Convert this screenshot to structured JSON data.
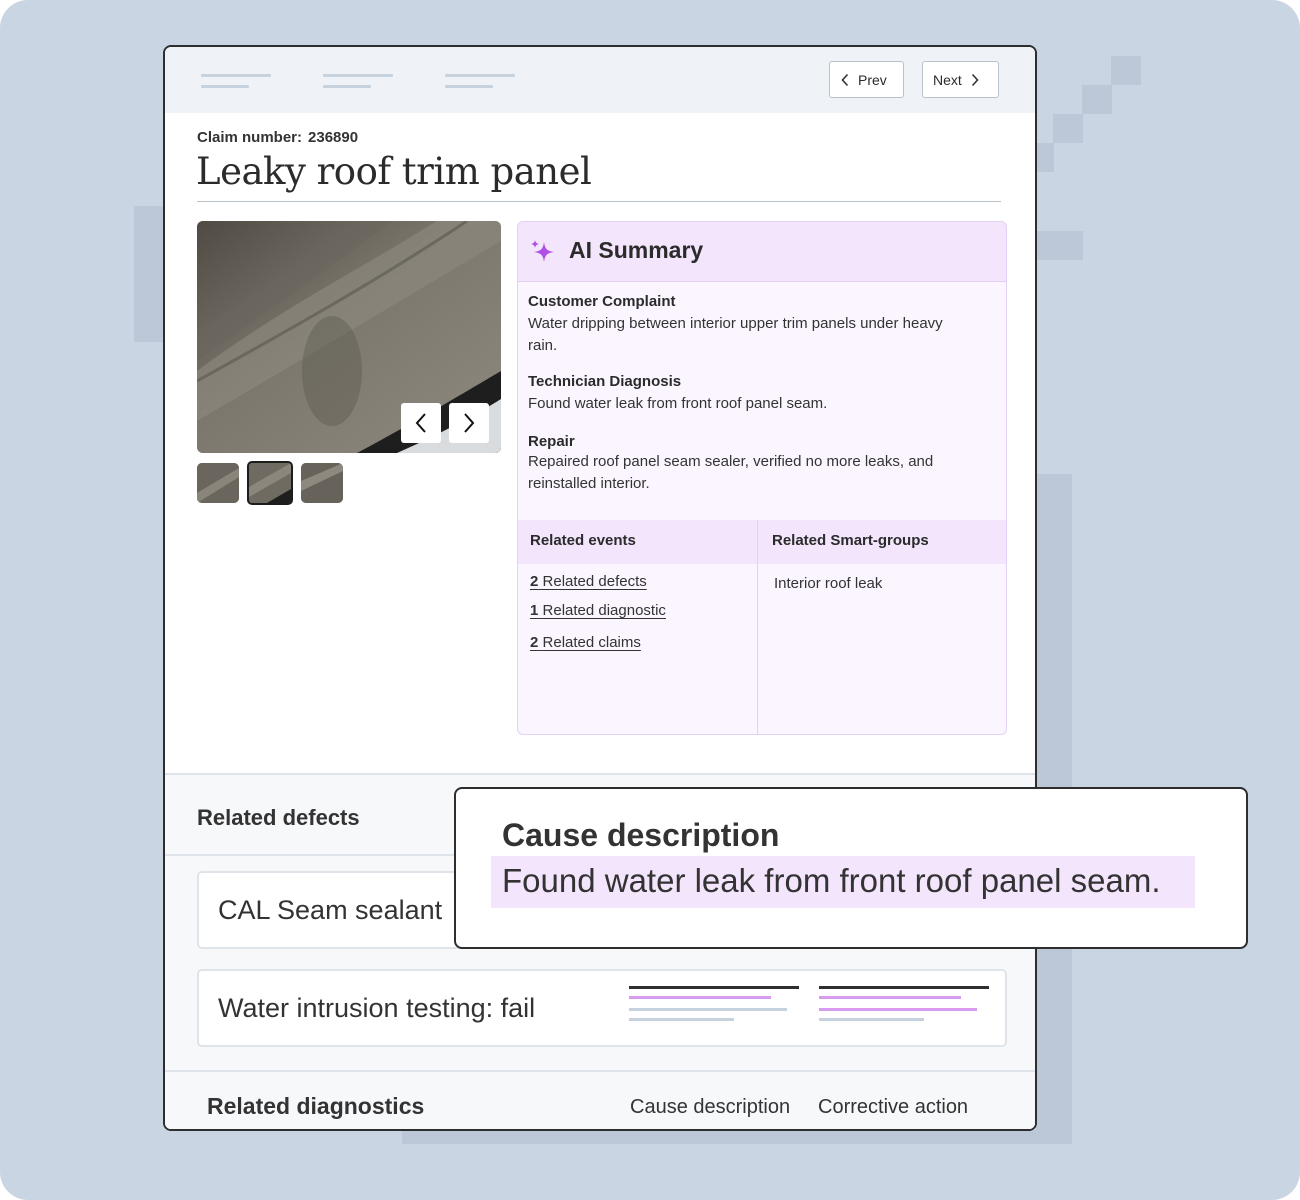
{
  "nav": {
    "prev_label": "Prev",
    "next_label": "Next"
  },
  "claim": {
    "number_label": "Claim number:",
    "number": "236890",
    "title": "Leaky roof trim panel"
  },
  "ai_summary": {
    "title": "AI Summary",
    "sections": [
      {
        "heading": "Customer Complaint",
        "text": "Water dripping between interior upper trim panels under heavy rain."
      },
      {
        "heading": "Technician Diagnosis",
        "text": "Found water leak from front roof panel seam."
      },
      {
        "heading": "Repair",
        "text": "Repaired roof panel seam sealer, verified no more leaks, and reinstalled interior."
      }
    ],
    "related_events_heading": "Related events",
    "related_smart_groups_heading": "Related Smart-groups",
    "related_events": [
      {
        "count": "2",
        "label": "Related defects"
      },
      {
        "count": "1",
        "label": "Related diagnostic"
      },
      {
        "count": "2",
        "label": "Related claims"
      }
    ],
    "smart_groups": [
      "Interior roof leak"
    ]
  },
  "related_defects": {
    "heading": "Related defects",
    "rows": [
      "CAL Seam sealant",
      "Water intrusion testing: fail"
    ]
  },
  "related_diagnostics": {
    "heading": "Related diagnostics",
    "columns": [
      "Cause description",
      "Corrective action"
    ]
  },
  "popup": {
    "heading": "Cause description",
    "text": "Found water leak from front roof panel seam."
  },
  "colors": {
    "accent_purple": "#b04fe6",
    "highlight": "#f3e5fc",
    "background": "#c9d5e2"
  }
}
